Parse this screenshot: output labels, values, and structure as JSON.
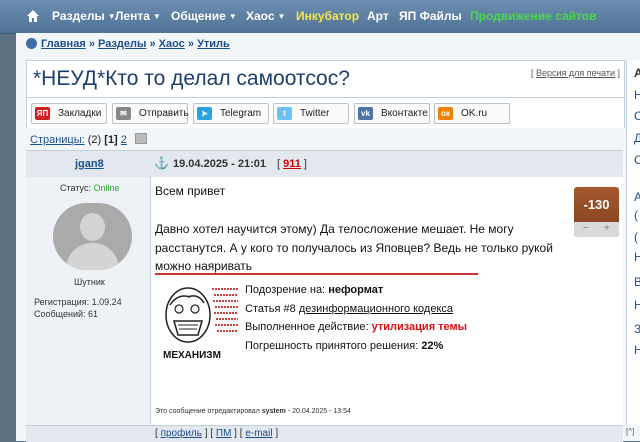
{
  "nav": {
    "items": [
      {
        "label": "Разделы",
        "dropdown": true,
        "color": "#ffffff"
      },
      {
        "label": "Лента",
        "dropdown": true,
        "color": "#ffffff"
      },
      {
        "label": "Общение",
        "dropdown": true,
        "color": "#ffffff"
      },
      {
        "label": "Хаос",
        "dropdown": true,
        "color": "#ffffff"
      },
      {
        "label": "Инкубатор",
        "dropdown": false,
        "color": "#f2e74a"
      },
      {
        "label": "Арт",
        "dropdown": false,
        "color": "#ffffff"
      },
      {
        "label": "ЯП Файлы",
        "dropdown": false,
        "color": "#ffffff"
      },
      {
        "label": "Продвижение сайтов",
        "dropdown": false,
        "color": "#4cd64c"
      }
    ]
  },
  "breadcrumb": {
    "items": [
      "Главная",
      "Разделы",
      "Хаос",
      "Утиль"
    ],
    "separator": "»"
  },
  "topic": {
    "title": "*НЕУД*Кто то делал самоотсос?",
    "print_link": "Версия для печати"
  },
  "share": [
    {
      "label": "Закладки",
      "icon": "yandex-icon",
      "icon_text": "ЯП",
      "color": "#cc2222"
    },
    {
      "label": "Отправить",
      "icon": "mail-icon",
      "icon_text": "✉",
      "color": "#888888"
    },
    {
      "label": "Telegram",
      "icon": "telegram-icon",
      "icon_text": "➤",
      "color": "#2aa3dd"
    },
    {
      "label": "Twitter",
      "icon": "twitter-icon",
      "icon_text": "t",
      "color": "#6fc0ee"
    },
    {
      "label": "Вконтакте",
      "icon": "vk-icon",
      "icon_text": "vk",
      "color": "#4c75a3"
    },
    {
      "label": "OK.ru",
      "icon": "ok-icon",
      "icon_text": "ок",
      "color": "#ee8208"
    }
  ],
  "pagination": {
    "label": "Страницы:",
    "count": "(2)",
    "current": "[1]",
    "next": "2"
  },
  "post": {
    "author": "jgan8",
    "date": "19.04.2025 - 21:01",
    "number": "911",
    "status_label": "Статус:",
    "status_value": "Online",
    "rank": "Шутник",
    "registration": "Регистрация: 1.09.24",
    "messages": "Сообщений: 61",
    "rating": "-130",
    "rating_minus": "−",
    "rating_plus": "+",
    "lines": [
      "Всем привет",
      "Давно хотел научится этому) Да телосложение мешает. Не могу",
      "расстанутся. А у кого то получалось из Яповцев? Ведь не только рукой",
      "можно наяривать"
    ],
    "moderation": {
      "image_caption": "МЕХАНИЗМ",
      "suspicion_label": "Подозрение на:",
      "suspicion_value": "неформат",
      "article_prefix": "Статья #8",
      "article_link": "дезинформационного кодекса",
      "action_label": "Выполненное действие:",
      "action_value": "утилизация темы",
      "error_label": "Погрешность принятого решения:",
      "error_value": "22%"
    },
    "edited_prefix": "Это сообщение отредактировал",
    "edited_by": "system",
    "edited_when": "- 20.04.2025 - 13:54"
  },
  "footer_links": [
    "профиль",
    "ПМ",
    "e-mail"
  ],
  "right_sidebar": {
    "header": "А",
    "letters": [
      "Н",
      "С",
      "Д",
      "С",
      "А",
      "(",
      "(",
      "Н",
      "В",
      "Н",
      "З",
      "Н"
    ],
    "corner": "[^]"
  }
}
